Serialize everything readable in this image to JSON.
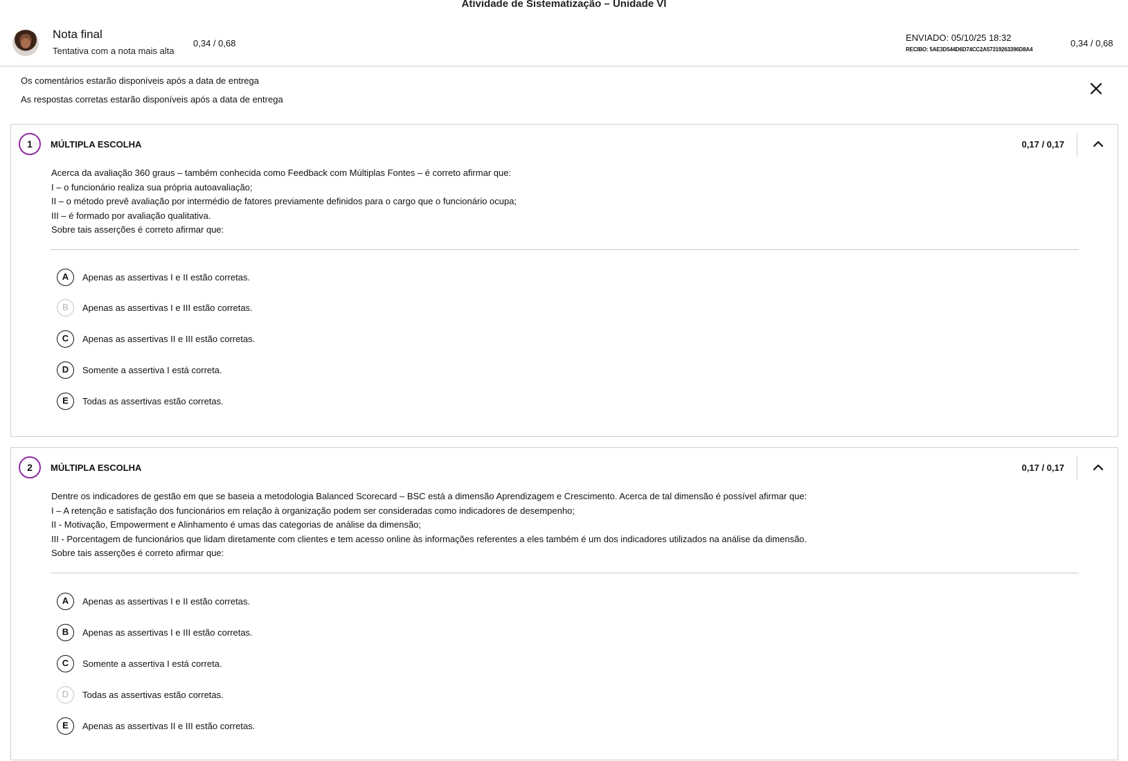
{
  "page": {
    "title": "Atividade de Sistematização – Unidade VI"
  },
  "header": {
    "grade_title": "Nota final",
    "grade_subtitle": "Tentativa com a nota mais alta",
    "score_left": "0,34 / 0,68",
    "sent": "ENVIADO: 05/10/25 18:32",
    "receipt": "RECIBO: 5AE3D544D6D74CC2A57319263396D8A4",
    "score_right": "0,34 / 0,68"
  },
  "notices": [
    "Os comentários estarão disponíveis após a data de entrega",
    "As respostas corretas estarão disponíveis após a data de entrega"
  ],
  "questions": [
    {
      "number": "1",
      "type": "MÚLTIPLA ESCOLHA",
      "score": "0,17 / 0,17",
      "text": [
        "Acerca da avaliação 360 graus – também conhecida como Feedback com Múltiplas Fontes – é correto afirmar que:",
        "I – o funcionário realiza sua própria autoavaliação;",
        "II – o método prevê avaliação por intermédio de fatores previamente definidos para o cargo que o funcionário ocupa;",
        "III – é formado por avaliação qualitativa.",
        "Sobre tais asserções é correto afirmar que:"
      ],
      "options": [
        {
          "letter": "A",
          "text": "Apenas as assertivas I e II estão corretas."
        },
        {
          "letter": "B",
          "text": "Apenas as assertivas I e III estão corretas."
        },
        {
          "letter": "C",
          "text": "Apenas as assertivas II e III estão corretas."
        },
        {
          "letter": "D",
          "text": "Somente a assertiva I está correta."
        },
        {
          "letter": "E",
          "text": "Todas as assertivas estão corretas."
        }
      ]
    },
    {
      "number": "2",
      "type": "MÚLTIPLA ESCOLHA",
      "score": "0,17 / 0,17",
      "text": [
        "Dentre os indicadores de gestão em que se baseia a metodologia Balanced Scorecard – BSC está a dimensão Aprendizagem e Crescimento. Acerca de tal dimensão é possível afirmar que:",
        "I – A retenção e satisfação dos funcionários em relação à organização podem ser consideradas como indicadores de desempenho;",
        "II - Motivação, Empowerment e Alinhamento é umas das categorias de análise da dimensão;",
        "III - Porcentagem de funcionários que lidam diretamente com clientes e tem acesso online às informações referentes a eles também é um dos indicadores utilizados na análise da dimensão.",
        "Sobre tais asserções é correto afirmar que:"
      ],
      "options": [
        {
          "letter": "A",
          "text": "Apenas as assertivas I e II estão corretas."
        },
        {
          "letter": "B",
          "text": "Apenas as assertivas I e III estão corretas."
        },
        {
          "letter": "C",
          "text": "Somente a assertiva I está correta."
        },
        {
          "letter": "D",
          "text": "Todas as assertivas estão corretas."
        },
        {
          "letter": "E",
          "text": "Apenas as assertivas II e III estão corretas."
        }
      ]
    }
  ],
  "icons": {
    "close": "close-icon",
    "collapse": "chevron-up-icon"
  },
  "colors": {
    "accent": "#8e2aa0"
  }
}
